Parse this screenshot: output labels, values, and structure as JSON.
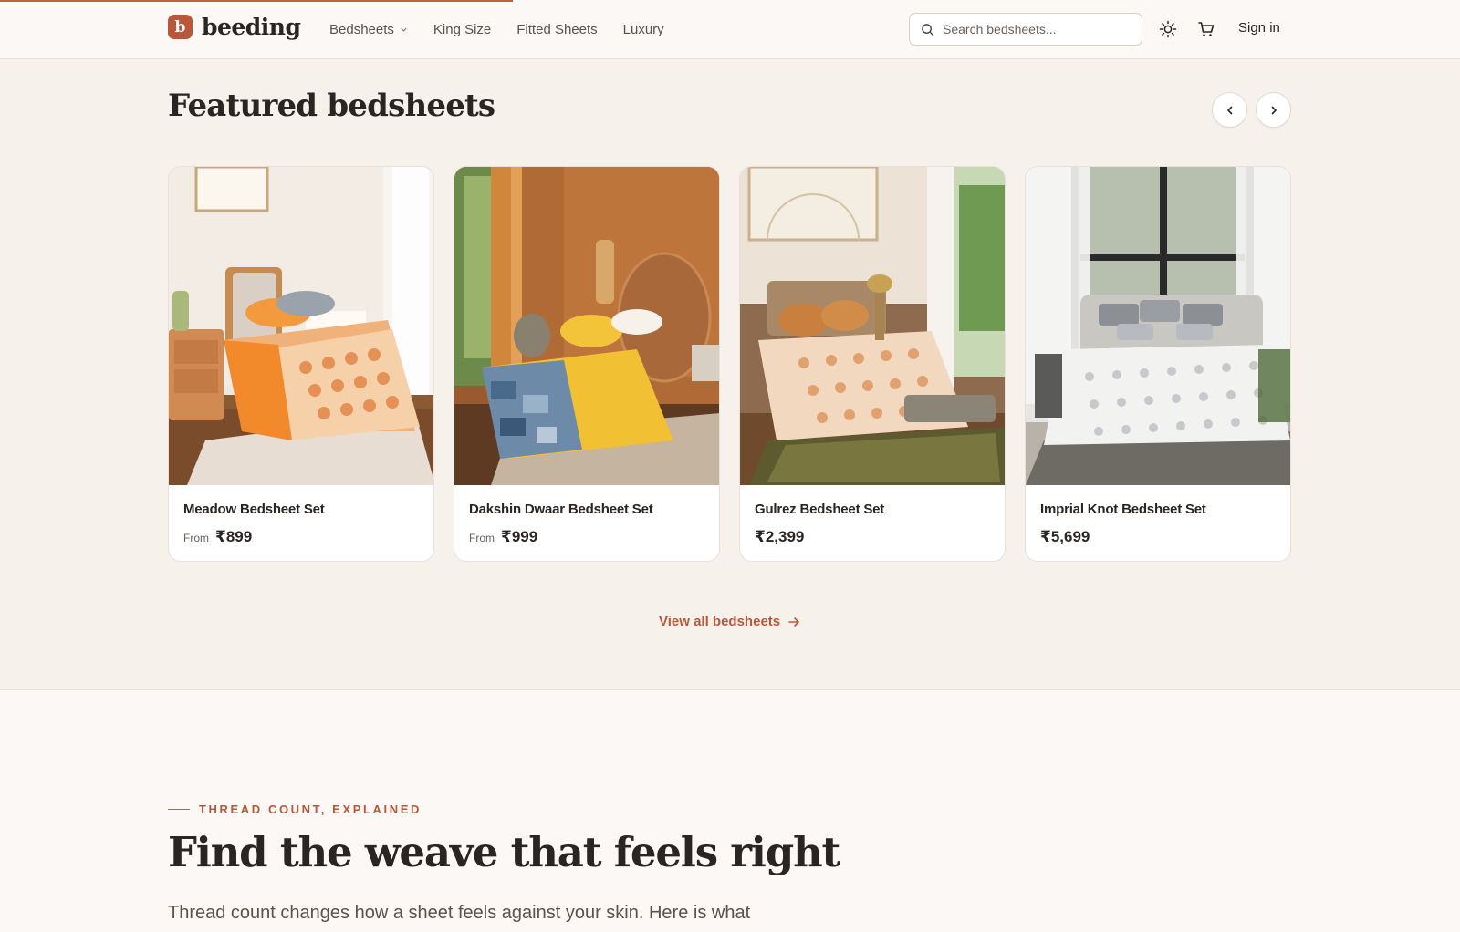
{
  "brand": {
    "logo_letter": "b",
    "name": "beeding",
    "accent": "#b9573b"
  },
  "nav": {
    "items": [
      {
        "label": "Bedsheets",
        "has_dropdown": true
      },
      {
        "label": "King Size"
      },
      {
        "label": "Fitted Sheets"
      },
      {
        "label": "Luxury"
      }
    ]
  },
  "search": {
    "placeholder": "Search bedsheets..."
  },
  "header_actions": {
    "theme_icon": "sun-icon",
    "cart_icon": "cart-icon",
    "sign_in": "Sign in"
  },
  "featured": {
    "title": "Featured bedsheets",
    "products": [
      {
        "name": "Meadow Bedsheet Set",
        "from_label": "From",
        "price": "₹899"
      },
      {
        "name": "Dakshin Dwaar Bedsheet Set",
        "from_label": "From",
        "price": "₹999"
      },
      {
        "name": "Gulrez Bedsheet Set",
        "from_label": "",
        "price": "₹2,399"
      },
      {
        "name": "Imprial Knot Bedsheet Set",
        "from_label": "",
        "price": "₹5,699"
      }
    ],
    "view_all": "View all bedsheets"
  },
  "thread_count": {
    "eyebrow": "THREAD COUNT, EXPLAINED",
    "title": "Find the weave that feels right",
    "intro": "Thread count changes how a sheet feels against your skin. Here is what"
  }
}
